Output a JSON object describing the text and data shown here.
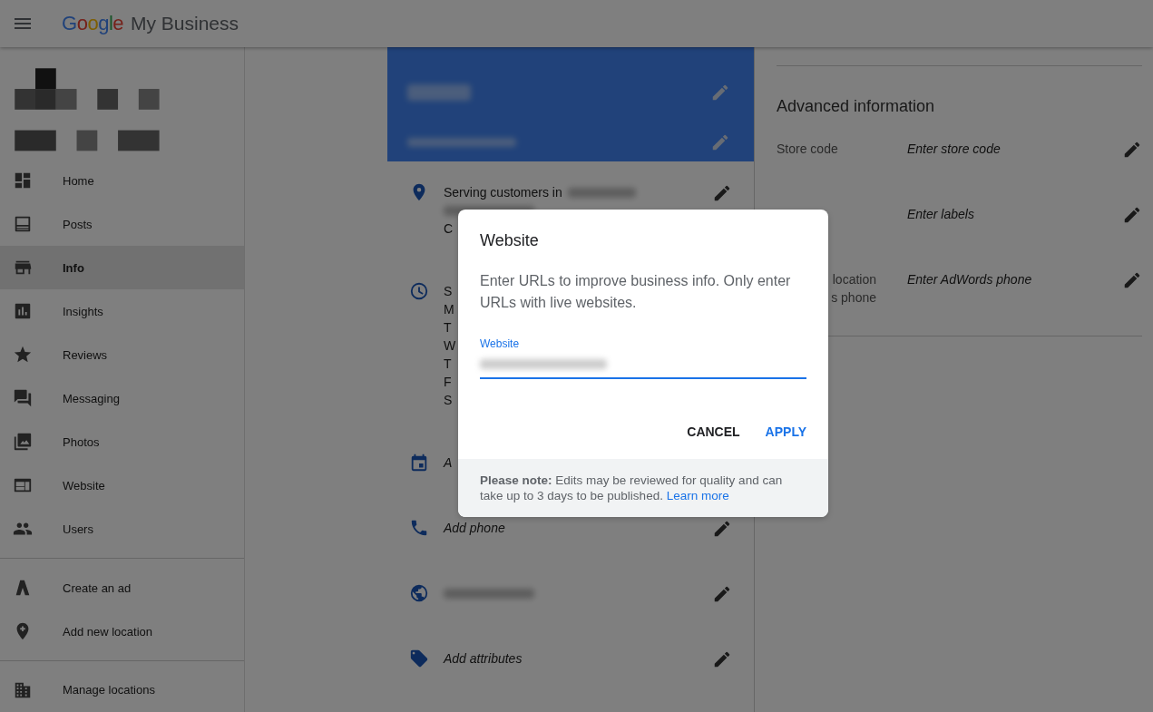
{
  "header": {
    "logo": "Google",
    "product": "My Business"
  },
  "sidebar": {
    "groups": [
      [
        {
          "label": "Home",
          "selected": false
        },
        {
          "label": "Posts",
          "selected": false
        },
        {
          "label": "Info",
          "selected": true
        },
        {
          "label": "Insights",
          "selected": false
        },
        {
          "label": "Reviews",
          "selected": false
        },
        {
          "label": "Messaging",
          "selected": false
        },
        {
          "label": "Photos",
          "selected": false
        },
        {
          "label": "Website",
          "selected": false
        },
        {
          "label": "Users",
          "selected": false
        }
      ],
      [
        {
          "label": "Create an ad",
          "selected": false
        },
        {
          "label": "Add new location",
          "selected": false
        }
      ],
      [
        {
          "label": "Manage locations",
          "selected": false
        }
      ]
    ]
  },
  "card": {
    "rows": [
      {
        "lines": [
          {
            "kind": "text_redacted",
            "text": "Serving customers in"
          },
          {
            "kind": "redacted"
          },
          {
            "kind": "text",
            "text": "C"
          }
        ]
      },
      {
        "edit_icon": false,
        "lines": [
          {
            "kind": "text",
            "text": "S"
          },
          {
            "kind": "text",
            "text": "M"
          },
          {
            "kind": "text",
            "text": "T"
          },
          {
            "kind": "text",
            "text": "W"
          },
          {
            "kind": "text",
            "text": "T"
          },
          {
            "kind": "text",
            "text": "F"
          },
          {
            "kind": "text",
            "text": "S"
          }
        ]
      },
      {
        "kind": "placeholder",
        "edit_icon": false,
        "lines": [
          {
            "kind": "text",
            "text": "A"
          }
        ]
      },
      {
        "kind": "placeholder",
        "lines": [
          {
            "kind": "text",
            "text": "Add phone"
          }
        ]
      },
      {
        "lines": [
          {
            "kind": "redacted"
          }
        ]
      },
      {
        "kind": "placeholder",
        "lines": [
          {
            "kind": "text",
            "text": "Add attributes"
          }
        ]
      }
    ]
  },
  "advanced": {
    "title": "Advanced information",
    "rows": [
      {
        "kind": "full",
        "label": [
          "Store code"
        ],
        "value": "Enter store code"
      },
      {
        "kind": "hidden",
        "label": [],
        "value": "Enter labels"
      },
      {
        "kind": "cut",
        "label": [
          "location",
          "s phone"
        ],
        "value": "Enter AdWords phone"
      }
    ]
  },
  "dialog": {
    "title": "Website",
    "body": "Enter URLs to improve business info. Only enter URLs with live websites.",
    "field": {
      "label": "Website"
    },
    "buttons": [
      {
        "label": "CANCEL",
        "kind": "secondary"
      },
      {
        "label": "APPLY",
        "kind": "primary"
      }
    ],
    "note": "**Please note:** Edits may be reviewed for quality and can take up to 3 days to be published.",
    "link": "Learn more"
  }
}
